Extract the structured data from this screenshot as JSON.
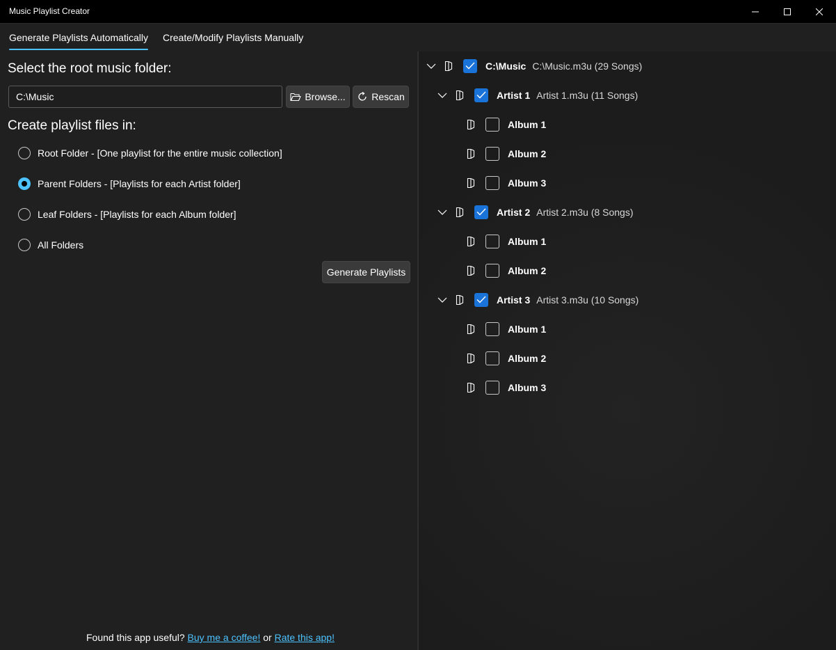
{
  "window": {
    "title": "Music Playlist Creator"
  },
  "tabs": [
    {
      "label": "Generate Playlists Automatically",
      "active": true
    },
    {
      "label": "Create/Modify Playlists Manually",
      "active": false
    }
  ],
  "left": {
    "root_heading": "Select the root music folder:",
    "root_path": "C:\\Music",
    "browse_label": "Browse...",
    "rescan_label": "Rescan",
    "create_heading": "Create playlist files in:",
    "options": [
      {
        "label": "Root Folder - [One playlist for the entire music collection]",
        "selected": false
      },
      {
        "label": "Parent Folders - [Playlists for each Artist folder]",
        "selected": true
      },
      {
        "label": "Leaf Folders - [Playlists for each Album folder]",
        "selected": false
      },
      {
        "label": "All Folders",
        "selected": false
      }
    ],
    "generate_label": "Generate Playlists"
  },
  "footer": {
    "prefix": "Found this app useful?",
    "coffee_link": "Buy me a coffee!",
    "middle": "or",
    "rate_link": "Rate this app!"
  },
  "tree": {
    "root": {
      "name": "C:\\Music",
      "info": "C:\\Music.m3u (29 Songs)",
      "checked": true,
      "expanded": true
    },
    "artists": [
      {
        "name": "Artist 1",
        "info": "Artist 1.m3u (11 Songs)",
        "checked": true,
        "expanded": true,
        "albums": [
          {
            "name": "Album 1",
            "checked": false
          },
          {
            "name": "Album 2",
            "checked": false
          },
          {
            "name": "Album 3",
            "checked": false
          }
        ]
      },
      {
        "name": "Artist 2",
        "info": "Artist 2.m3u (8 Songs)",
        "checked": true,
        "expanded": true,
        "albums": [
          {
            "name": "Album 1",
            "checked": false
          },
          {
            "name": "Album 2",
            "checked": false
          }
        ]
      },
      {
        "name": "Artist 3",
        "info": "Artist 3.m3u (10 Songs)",
        "checked": true,
        "expanded": true,
        "albums": [
          {
            "name": "Album 1",
            "checked": false
          },
          {
            "name": "Album 2",
            "checked": false
          },
          {
            "name": "Album 3",
            "checked": false
          }
        ]
      }
    ]
  },
  "colors": {
    "accent": "#4cc2ff",
    "checkbox": "#1a73d9",
    "background": "#202020",
    "titlebar": "#000000"
  }
}
